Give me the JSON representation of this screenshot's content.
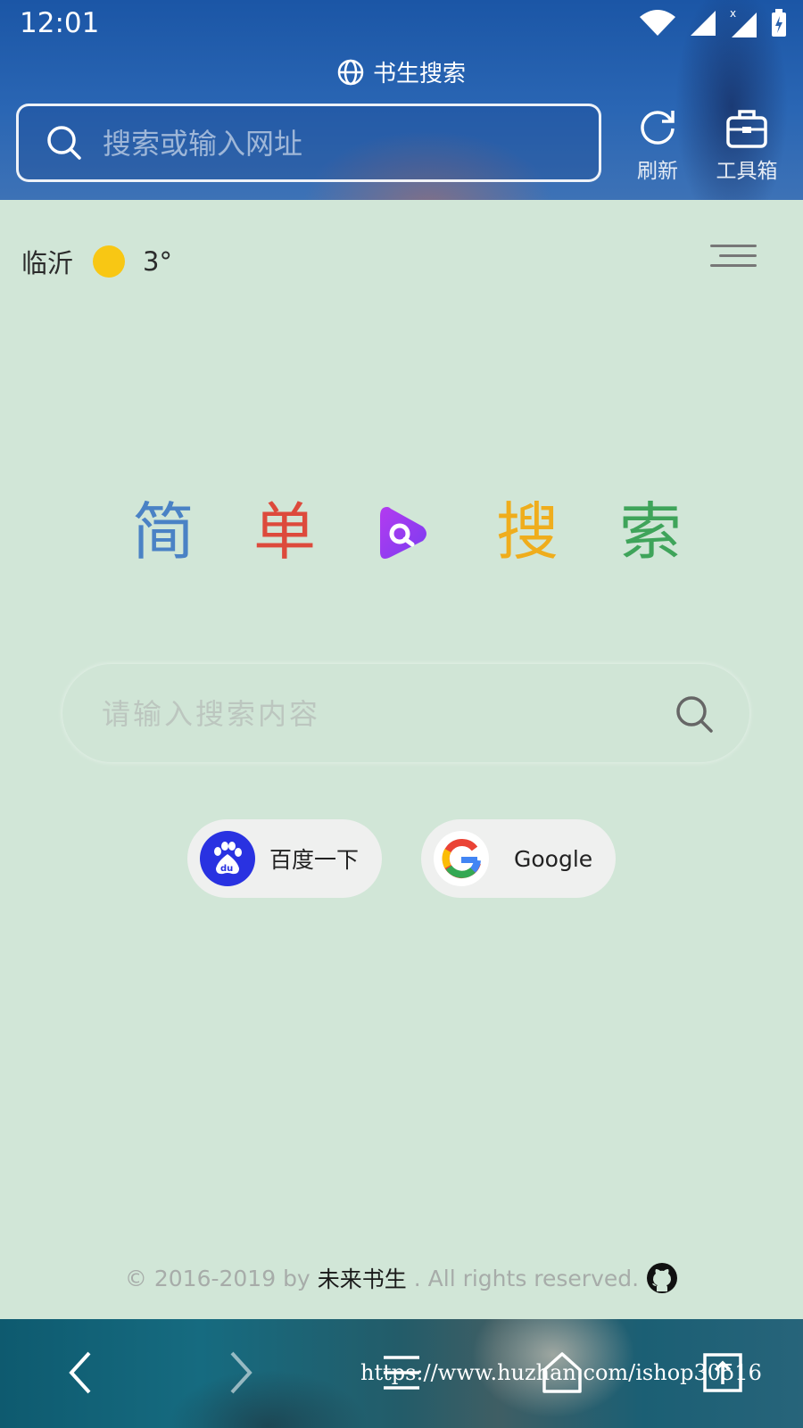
{
  "status_bar": {
    "time": "12:01"
  },
  "browser": {
    "title": "书生搜索",
    "address_placeholder": "搜索或输入网址",
    "refresh_label": "刷新",
    "toolbox_label": "工具箱"
  },
  "weather": {
    "city": "临沂",
    "temperature": "3°"
  },
  "logo": {
    "chars": [
      "简",
      "单",
      "搜",
      "索"
    ],
    "colors": [
      "#4a82c5",
      "#dd4a3c",
      "#efad1c",
      "#3fa45a"
    ]
  },
  "search": {
    "placeholder": "请输入搜索内容"
  },
  "engines": [
    {
      "label": "百度一下",
      "icon": "baidu-paw-icon",
      "color": "#2932e1"
    },
    {
      "label": "Google",
      "icon": "google-icon"
    }
  ],
  "footer": {
    "prefix": "© 2016-2019 by",
    "author": "未来书生",
    "suffix": ". All rights reserved."
  },
  "watermark": "https://www.huzhan.com/ishop30516"
}
